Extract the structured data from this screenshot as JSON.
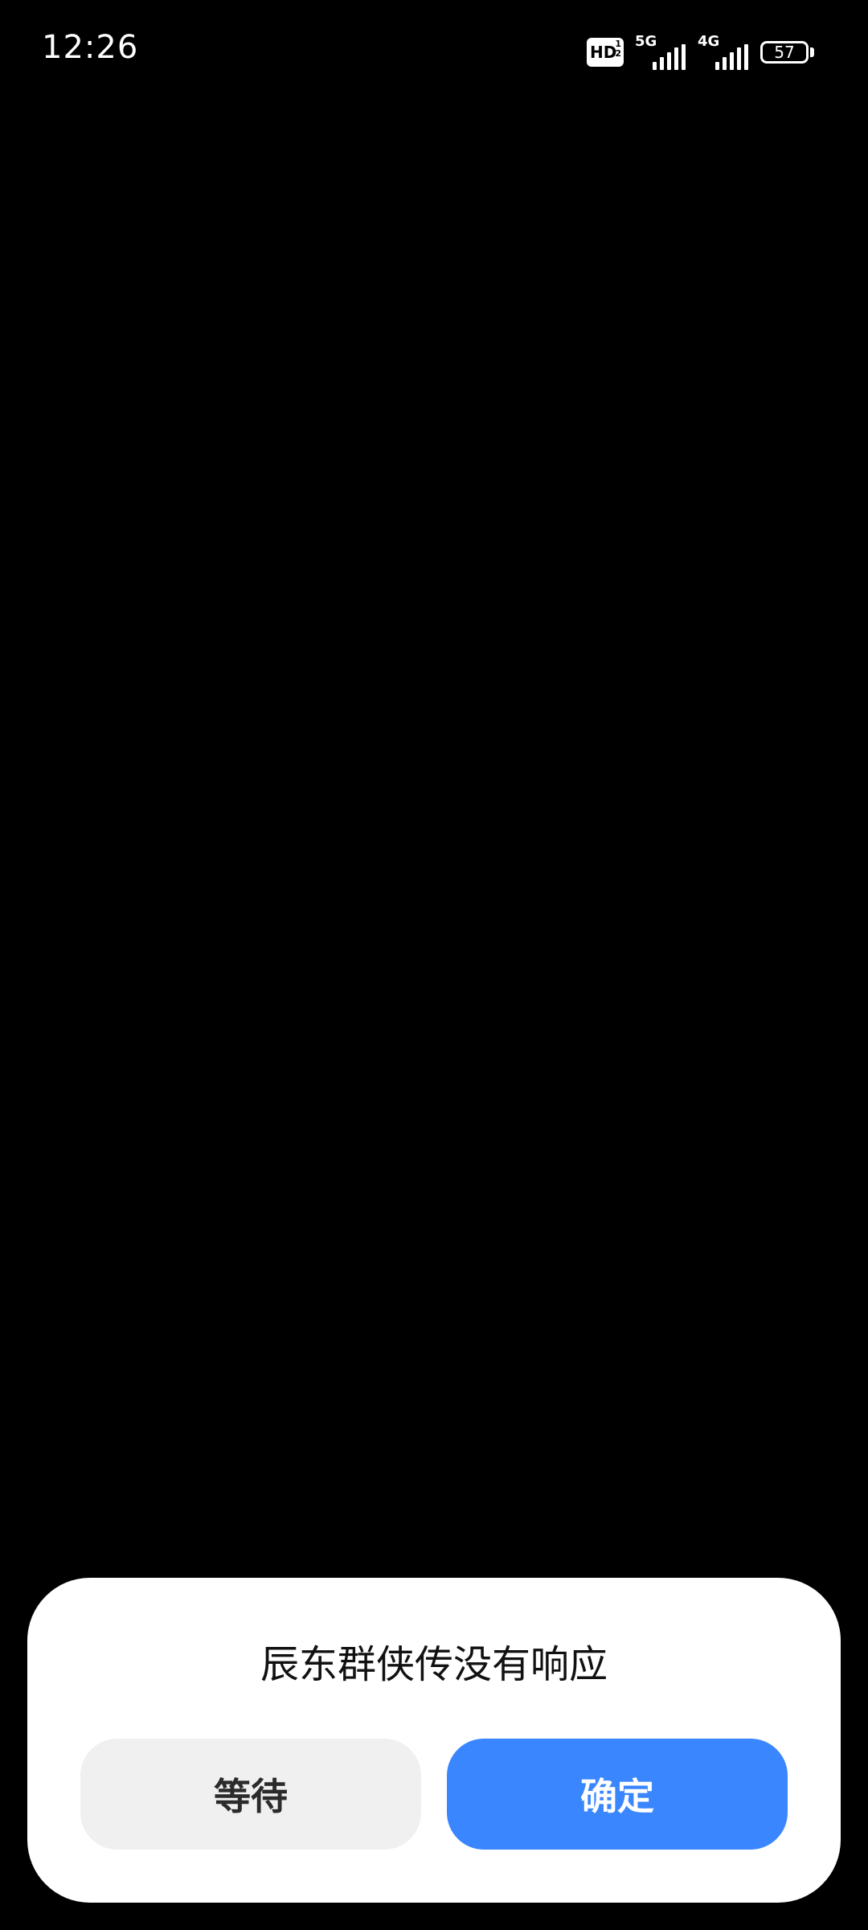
{
  "status_bar": {
    "time": "12:26",
    "hd_label": "HD",
    "hd_sub": "1\n2",
    "signal1_label": "5G",
    "signal2_label": "4G",
    "battery_level": "57"
  },
  "dialog": {
    "title": "辰东群侠传没有响应",
    "wait_label": "等待",
    "ok_label": "确定"
  },
  "colors": {
    "background": "#000000",
    "dialog_bg": "#ffffff",
    "wait_button_bg": "#f0f0f0",
    "ok_button_bg": "#3a86ff"
  },
  "icons": {
    "signal": "signal-bars-icon",
    "battery": "battery-icon",
    "hd": "hd-voice-icon"
  }
}
